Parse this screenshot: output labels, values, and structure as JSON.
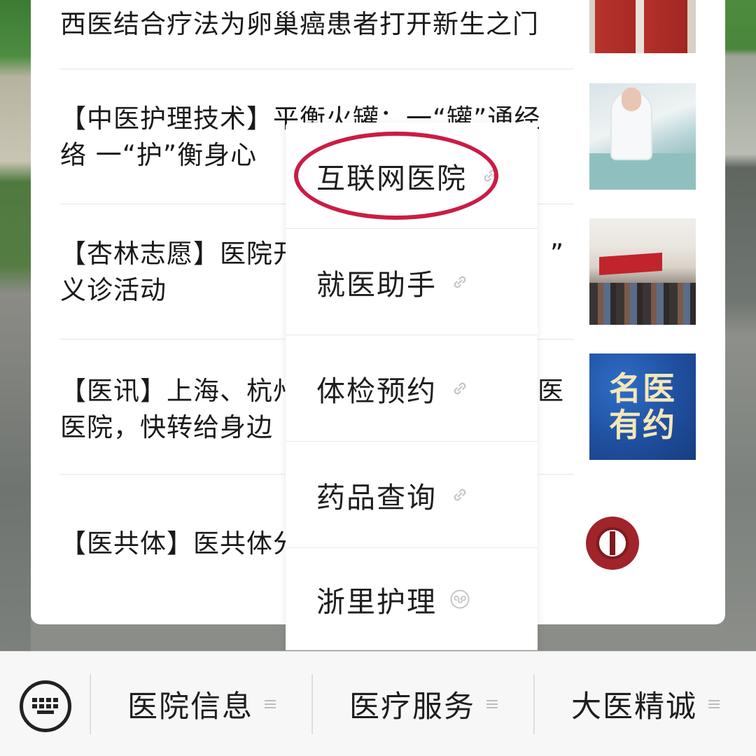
{
  "articles": [
    {
      "title": "西医结合疗法为卵巢癌患者打开新生之门",
      "thumb": "banners-photo"
    },
    {
      "title": "【中医护理技术】平衡火罐：一“罐”通经络 一“护”衡身心",
      "thumb": "nurse-photo"
    },
    {
      "title": "【杏林志愿】医院开展“……”义诊活动",
      "thumb": "event-photo"
    },
    {
      "title": "【医讯】上海、杭州……医医院，快转给身边……",
      "thumb": "doctor-banner"
    },
    {
      "title": "【医共体】医共体分……",
      "thumb": "hospital-logo"
    }
  ],
  "article_lines": {
    "a0": "西医结合疗法为卵巢癌患者打开新生之门",
    "a1_l1": "【中医护理技术】平衡火罐：一“罐”通经",
    "a1_l2": "络  一“护”衡身心",
    "a2_l1": "【杏林志愿】医院开展“",
    "a2_l1_end": "”",
    "a2_l2": "义诊活动",
    "a3_l1": "【医讯】上海、杭州",
    "a3_l1_end": "医",
    "a3_l2": "医院，快转给身边",
    "a4_l1": "【医共体】医共体分"
  },
  "doctor_banner": {
    "line1": "名医",
    "line2": "有约"
  },
  "popup_menu": {
    "items": [
      {
        "label": "互联网医院",
        "icon": "link-icon",
        "highlighted": true
      },
      {
        "label": "就医助手",
        "icon": "link-icon"
      },
      {
        "label": "体检预约",
        "icon": "link-icon"
      },
      {
        "label": "药品查询",
        "icon": "link-icon"
      },
      {
        "label": "浙里护理",
        "icon": "mini-program-icon"
      }
    ]
  },
  "bottom_bar": {
    "keyboard_icon": "keyboard-icon",
    "tabs": [
      {
        "label": "医院信息",
        "icon": "menu-lines-icon"
      },
      {
        "label": "医疗服务",
        "icon": "menu-lines-icon"
      },
      {
        "label": "大医精诚",
        "icon": "menu-lines-icon"
      }
    ]
  },
  "colors": {
    "highlight_oval": "#c91d45",
    "doctor_banner_bg": "#1f4f9e",
    "doctor_banner_text": "#f4e7b9"
  }
}
